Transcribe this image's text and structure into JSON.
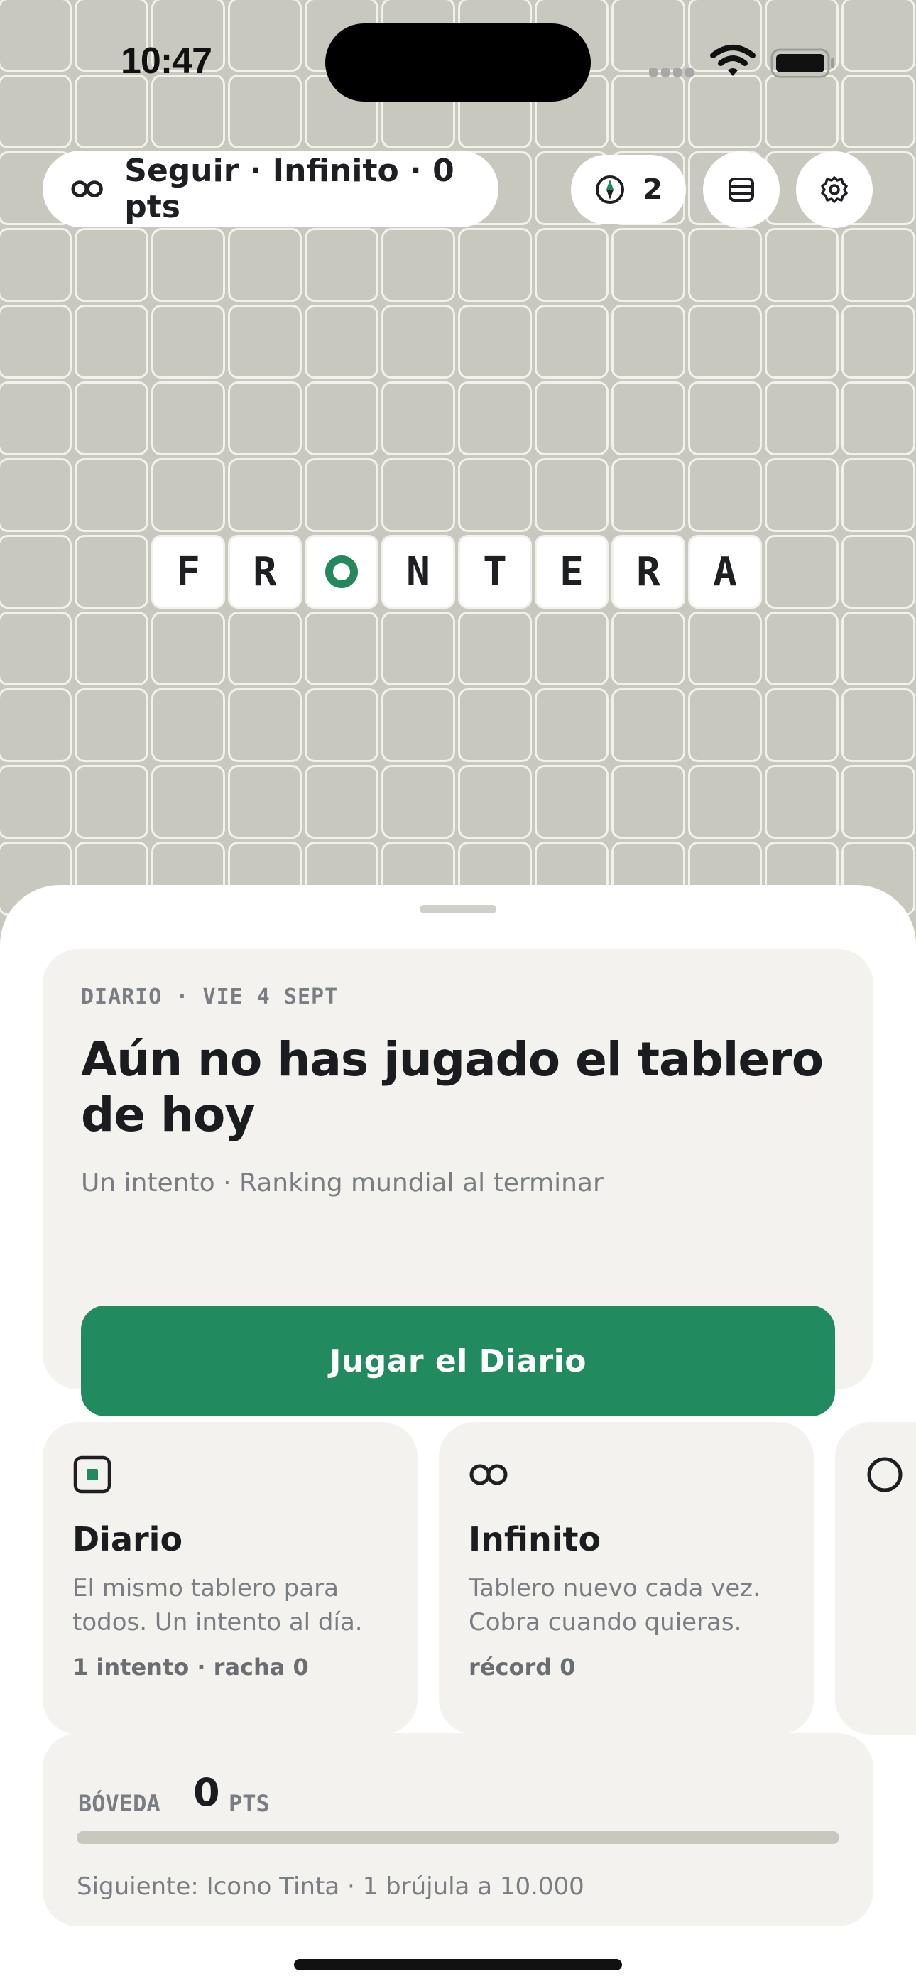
{
  "status_bar": {
    "time": "10:47"
  },
  "header": {
    "mode_pill": "Seguir · Infinito · 0 pts",
    "compass_count": "2"
  },
  "board": {
    "word_tiles": [
      "F",
      "R",
      "",
      "N",
      "T",
      "E",
      "R",
      "A"
    ],
    "target_tile_index": 2
  },
  "daily": {
    "kicker": "DIARIO · VIE 4 SEPT",
    "title": "Aún no has jugado el tablero de hoy",
    "subtitle": "Un intento · Ranking mundial al terminar",
    "button_label": "Jugar el Diario"
  },
  "modes": [
    {
      "title": "Diario",
      "description": "El mismo tablero para todos. Un intento al día.",
      "stat": "1 intento · racha 0"
    },
    {
      "title": "Infinito",
      "description": "Tablero nuevo cada vez. Cobra cuando quieras.",
      "stat": "récord 0"
    }
  ],
  "vault": {
    "label": "BÓVEDA",
    "points": "0",
    "unit": "PTS",
    "progress": 0,
    "next": "Siguiente: Icono Tinta · 1 brújula a 10.000"
  },
  "colors": {
    "accent": "#218a5e",
    "board": "#c9c8bf",
    "card": "#f3f2ee"
  }
}
